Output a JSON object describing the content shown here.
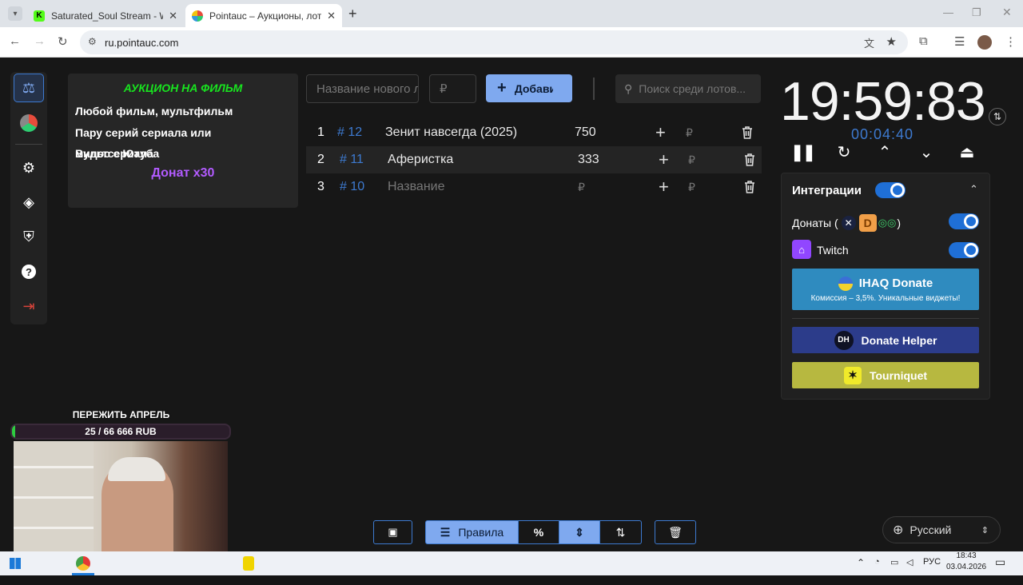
{
  "browser": {
    "tabs": [
      {
        "title": "Saturated_Soul Stream - Watch",
        "active": false,
        "favicon_color": "#53fc18"
      },
      {
        "title": "Pointauc – Аукционы, лотереи",
        "active": true,
        "favicon_color": "#9a4bd8"
      }
    ],
    "url": "ru.pointauc.com"
  },
  "rules": {
    "title": "АУКЦИОН НА ФИЛЬМ",
    "lines": [
      "Любой фильм, мультфильм",
      "Пару серий сериала или мультсериала",
      "Видос с Ютуба"
    ],
    "donate": "Донат х30"
  },
  "form": {
    "name_placeholder": "Название нового лота",
    "amount_placeholder": "₽",
    "add_label": "Добавить",
    "search_placeholder": "Поиск среди лотов..."
  },
  "lots": [
    {
      "rank": "1",
      "id": "# 12",
      "name": "Зенит навсегда (2025)",
      "amount": "750",
      "currency": "₽"
    },
    {
      "rank": "2",
      "id": "# 11",
      "name": "Аферистка",
      "amount": "333",
      "currency": "₽"
    },
    {
      "rank": "3",
      "id": "# 10",
      "name": "Название",
      "amount": "₽",
      "currency": "₽"
    }
  ],
  "timer": {
    "main": "19:59:83",
    "sub": "00:04:40"
  },
  "integrations": {
    "title": "Интеграции",
    "enabled": true,
    "donations_label": "Донаты (",
    "donations_close": ")",
    "twitch_label": "Twitch",
    "ihaq_title": "IHAQ Donate",
    "ihaq_sub": "Комиссия – 3,5%. Уникальные виджеты!",
    "donate_helper": "Donate Helper",
    "tourniquet": "Tourniquet"
  },
  "bottom_bar": {
    "rules_label": "Правила",
    "percent_label": "%"
  },
  "language": "Русский",
  "overlay": {
    "goal_title": "ПЕРЕЖИТЬ АПРЕЛЬ",
    "goal_progress": "25 / 66 666 RUB",
    "goal_fraction": 0.0004
  },
  "taskbar": {
    "lang": "РУС",
    "time": "18:43",
    "date": "03.04.2026"
  },
  "colors": {
    "accent": "#3d7ad0",
    "button": "#7fa9ef",
    "rules_title": "#18e41f",
    "donate_text": "#b25bff",
    "ihaq": "#2f8bbf",
    "donate_helper": "#2c3c8a",
    "tourniquet": "#b7b840"
  }
}
